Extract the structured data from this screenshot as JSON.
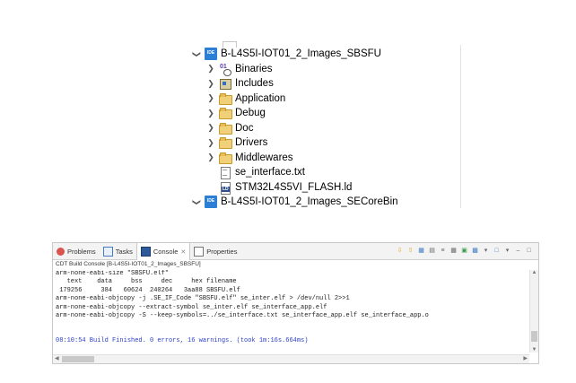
{
  "project_explorer": {
    "items": [
      {
        "label": "B-L4S5I-IOT01_2_Images_SBSFU",
        "icon": "project-icon",
        "twisty": "expanded",
        "level": 0
      },
      {
        "label": "Binaries",
        "icon": "binaries-icon",
        "twisty": "collapsed",
        "level": 1
      },
      {
        "label": "Includes",
        "icon": "includes-icon",
        "twisty": "collapsed",
        "level": 1
      },
      {
        "label": "Application",
        "icon": "folder-icon",
        "twisty": "collapsed",
        "level": 1
      },
      {
        "label": "Debug",
        "icon": "folder-icon",
        "twisty": "collapsed",
        "level": 1
      },
      {
        "label": "Doc",
        "icon": "folder-icon",
        "twisty": "collapsed",
        "level": 1
      },
      {
        "label": "Drivers",
        "icon": "folder-icon",
        "twisty": "collapsed",
        "level": 1
      },
      {
        "label": "Middlewares",
        "icon": "folder-icon",
        "twisty": "collapsed",
        "level": 1
      },
      {
        "label": "se_interface.txt",
        "icon": "text-file-icon",
        "twisty": "none",
        "level": 1
      },
      {
        "label": "STM32L4S5VI_FLASH.ld",
        "icon": "linker-file-icon",
        "twisty": "none",
        "level": 1
      },
      {
        "label": "B-L4S5I-IOT01_2_Images_SECoreBin",
        "icon": "project-icon",
        "twisty": "expanded",
        "level": 0
      }
    ]
  },
  "console_panel": {
    "tabs": [
      {
        "label": "Problems",
        "icon": "problems-icon",
        "active": false
      },
      {
        "label": "Tasks",
        "icon": "tasks-icon",
        "active": false
      },
      {
        "label": "Console",
        "icon": "console-icon",
        "active": true
      },
      {
        "label": "Properties",
        "icon": "properties-icon",
        "active": false
      }
    ],
    "subtitle": "CDT Build Console [B-L4S5I-IOT01_2_Images_SBSFU]",
    "lines": [
      "arm-none-eabi-size \"SBSFU.elf\"",
      "   text    data     bss     dec     hex filename",
      " 179256     384   60624  240264   3aa88 SBSFU.elf",
      "arm-none-eabi-objcopy -j .SE_IF_Code \"SBSFU.elf\" se_inter.elf > /dev/null 2>>1",
      "arm-none-eabi-objcopy --extract-symbol se_inter.elf se_interface_app.elf",
      "arm-none-eabi-objcopy -S --keep-symbols=../se_interface.txt se_interface_app.elf se_interface_app.o",
      "",
      "",
      "08:10:54 Build Finished. 0 errors, 16 warnings. (took 1m:16s.664ms)"
    ],
    "colors": {
      "finished_line": "#2a3fc4"
    }
  }
}
